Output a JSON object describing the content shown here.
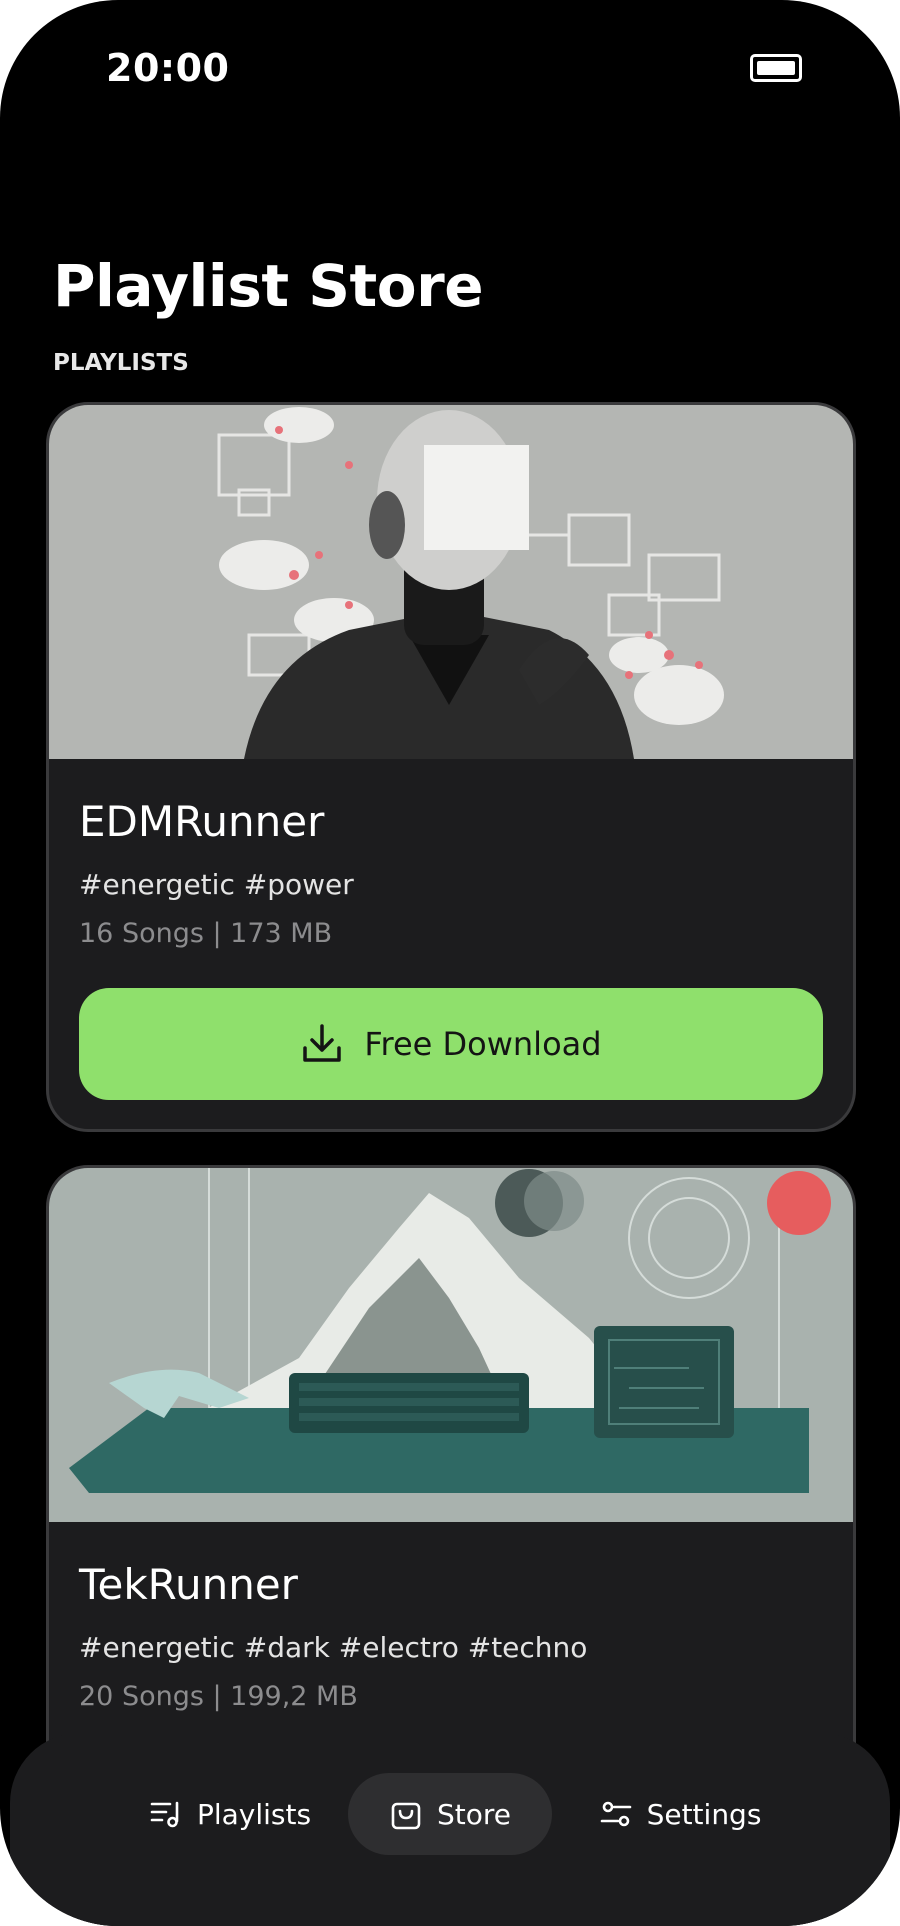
{
  "status_bar": {
    "time": "20:00"
  },
  "header": {
    "title": "Playlist Store",
    "section": "PLAYLISTS"
  },
  "playlists": [
    {
      "name": "EDMRunner",
      "tags": "#energetic #power",
      "meta": "16 Songs | 173 MB",
      "button_label": "Free Download"
    },
    {
      "name": "TekRunner",
      "tags": "#energetic #dark #electro #techno",
      "meta": "20 Songs | 199,2 MB"
    }
  ],
  "tabbar": {
    "tabs": [
      {
        "label": "Playlists",
        "icon": "playlist-icon"
      },
      {
        "label": "Store",
        "icon": "shopping-bag-icon",
        "active": true
      },
      {
        "label": "Settings",
        "icon": "sliders-icon"
      }
    ]
  },
  "colors": {
    "background": "#000000",
    "card": "#1c1c1e",
    "accent": "#8fe06c",
    "active_tab": "#2e2e30"
  }
}
